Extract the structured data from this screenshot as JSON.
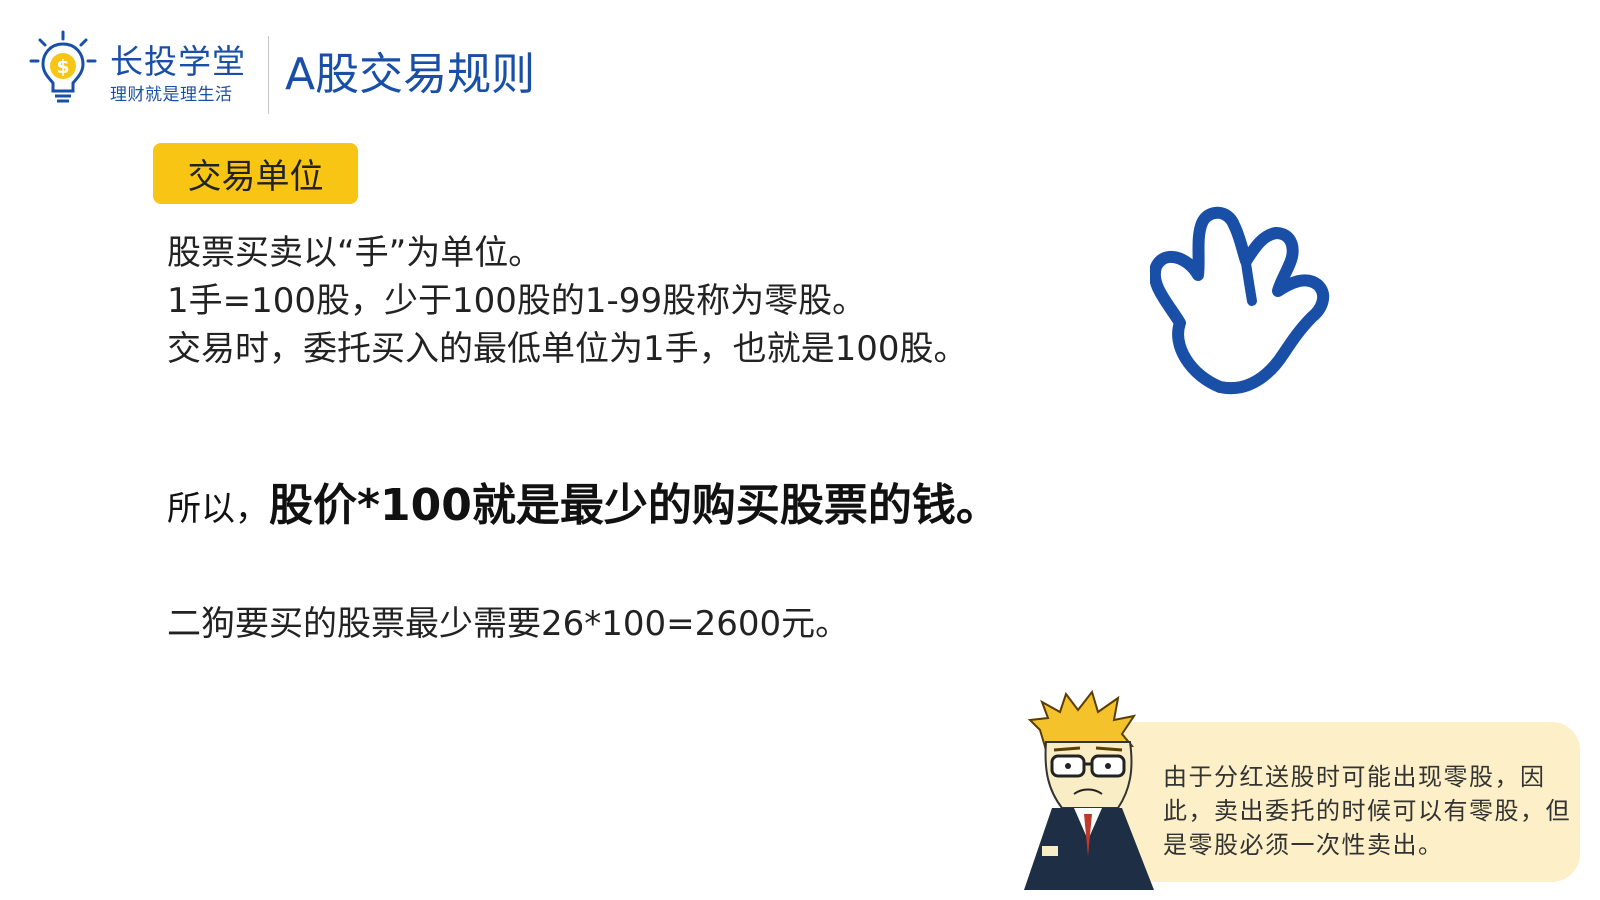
{
  "header": {
    "brand_name": "长投学堂",
    "brand_slogan": "理财就是理生活",
    "title": "A股交易规则",
    "logo_icon": "lightbulb-dollar-icon"
  },
  "section": {
    "tag": "交易单位"
  },
  "rules": {
    "lines": [
      "股票买卖以“手”为单位。",
      "1手=100股，少于100股的1-99股称为零股。",
      "交易时，委托买入的最低单位为1手，也就是100股。"
    ]
  },
  "emphasis": {
    "prefix": "所以，",
    "bold": "股价*100就是最少的购买股票的钱。"
  },
  "example": {
    "text": "二狗要买的股票最少需要26*100=2600元。"
  },
  "note": {
    "text": "由于分红送股时可能出现零股，因此，卖出委托的时候可以有零股，但是零股必须一次性卖出。"
  },
  "icons": {
    "hand": "hand-icon",
    "character": "cartoon-man-icon"
  },
  "colors": {
    "brand_blue": "#1a4fa8",
    "tag_yellow": "#f8c514",
    "note_bg": "#fdf0c8"
  }
}
